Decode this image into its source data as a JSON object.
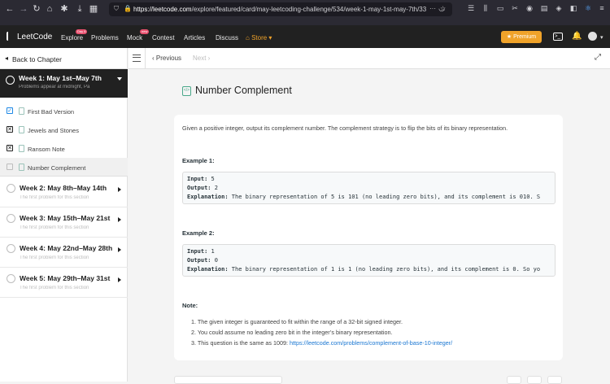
{
  "browser": {
    "url_host": "https://leetcode.com",
    "url_path": "/explore/featured/card/may-leetcoding-challenge/534/week-1-may-1st-may-7th/33"
  },
  "nav": {
    "logo": "LeetCode",
    "explore": "Explore",
    "explore_badge": "Day 8",
    "problems": "Problems",
    "mock": "Mock",
    "mock_badge": "new",
    "contest": "Contest",
    "articles": "Articles",
    "discuss": "Discuss",
    "store": "Store",
    "premium": "Premium"
  },
  "sidebar": {
    "back": "Back to Chapter",
    "current_week": {
      "title": "Week 1: May 1st–May 7th",
      "subtitle": "Problems appear at midnight, Pa"
    },
    "problems": [
      {
        "label": "First Bad Version",
        "status": "check"
      },
      {
        "label": "Jewels and Stones",
        "status": "x"
      },
      {
        "label": "Ransom Note",
        "status": "x"
      },
      {
        "label": "Number Complement",
        "status": "empty"
      }
    ],
    "weeks": [
      {
        "title": "Week 2: May 8th–May 14th",
        "subtitle": "The first problem for this section"
      },
      {
        "title": "Week 3: May 15th–May 21st",
        "subtitle": "The first problem for this section"
      },
      {
        "title": "Week 4: May 22nd–May 28th",
        "subtitle": "The first problem for this section"
      },
      {
        "title": "Week 5: May 29th–May 31st",
        "subtitle": "The first problem for this section"
      }
    ]
  },
  "toolbar": {
    "previous": "Previous",
    "next": "Next"
  },
  "problem": {
    "title": "Number Complement",
    "description": "Given a positive integer, output its complement number. The complement strategy is to flip the bits of its binary representation.",
    "example1": {
      "heading": "Example 1:",
      "input_label": "Input:",
      "input": "5",
      "output_label": "Output:",
      "output": "2",
      "explanation_label": "Explanation:",
      "explanation": "The binary representation of 5 is 101 (no leading zero bits), and its complement is 010. S"
    },
    "example2": {
      "heading": "Example 2:",
      "input_label": "Input:",
      "input": "1",
      "output_label": "Output:",
      "output": "0",
      "explanation_label": "Explanation:",
      "explanation": "The binary representation of 1 is 1 (no leading zero bits), and its complement is 0. So yo"
    },
    "note_heading": "Note:",
    "notes": [
      "The given integer is guaranteed to fit within the range of a 32-bit signed integer.",
      "You could assume no leading zero bit in the integer’s binary representation.",
      "This question is the same as 1009: "
    ],
    "note_link": "https://leetcode.com/problems/complement-of-base-10-integer/"
  },
  "colors": {
    "accent": "#f0a32a",
    "link": "#1976d2",
    "nav_bg": "#212121"
  }
}
